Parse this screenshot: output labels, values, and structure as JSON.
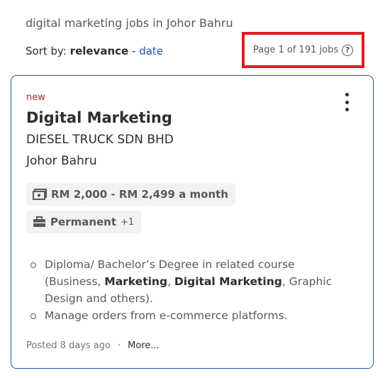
{
  "header": {
    "search_summary": "digital marketing jobs in Johor Bahru",
    "sort_label": "Sort by:",
    "sort_active": "relevance",
    "sort_separator": "-",
    "sort_alternative": "date",
    "page_count": "Page 1 of 191 jobs",
    "help_icon": "question-circle-icon"
  },
  "job": {
    "new_label": "new",
    "title": "Digital Marketing",
    "company": "DIESEL TRUCK SDN BHD",
    "location": "Johor Bahru",
    "salary": "RM 2,000 - RM 2,499 a month",
    "salary_icon": "money-icon",
    "job_type": "Permanent",
    "job_type_extra": "+1",
    "job_type_icon": "briefcase-icon",
    "snippet": {
      "b1_part1": "Diploma/ Bachelor’s Degree in related course (Business, ",
      "b1_bold1": "Marketing",
      "b1_part2": ", ",
      "b1_bold2": "Digital Marketing",
      "b1_part3": ", Graphic Design and others).",
      "b2": "Manage orders from e-commerce platforms."
    },
    "posted": "Posted 8 days ago",
    "separator": "·",
    "more_link": "More..."
  },
  "colors": {
    "accent_blue": "#2557a7",
    "highlight_red": "#e41b23",
    "new_tag": "#a9252b"
  }
}
